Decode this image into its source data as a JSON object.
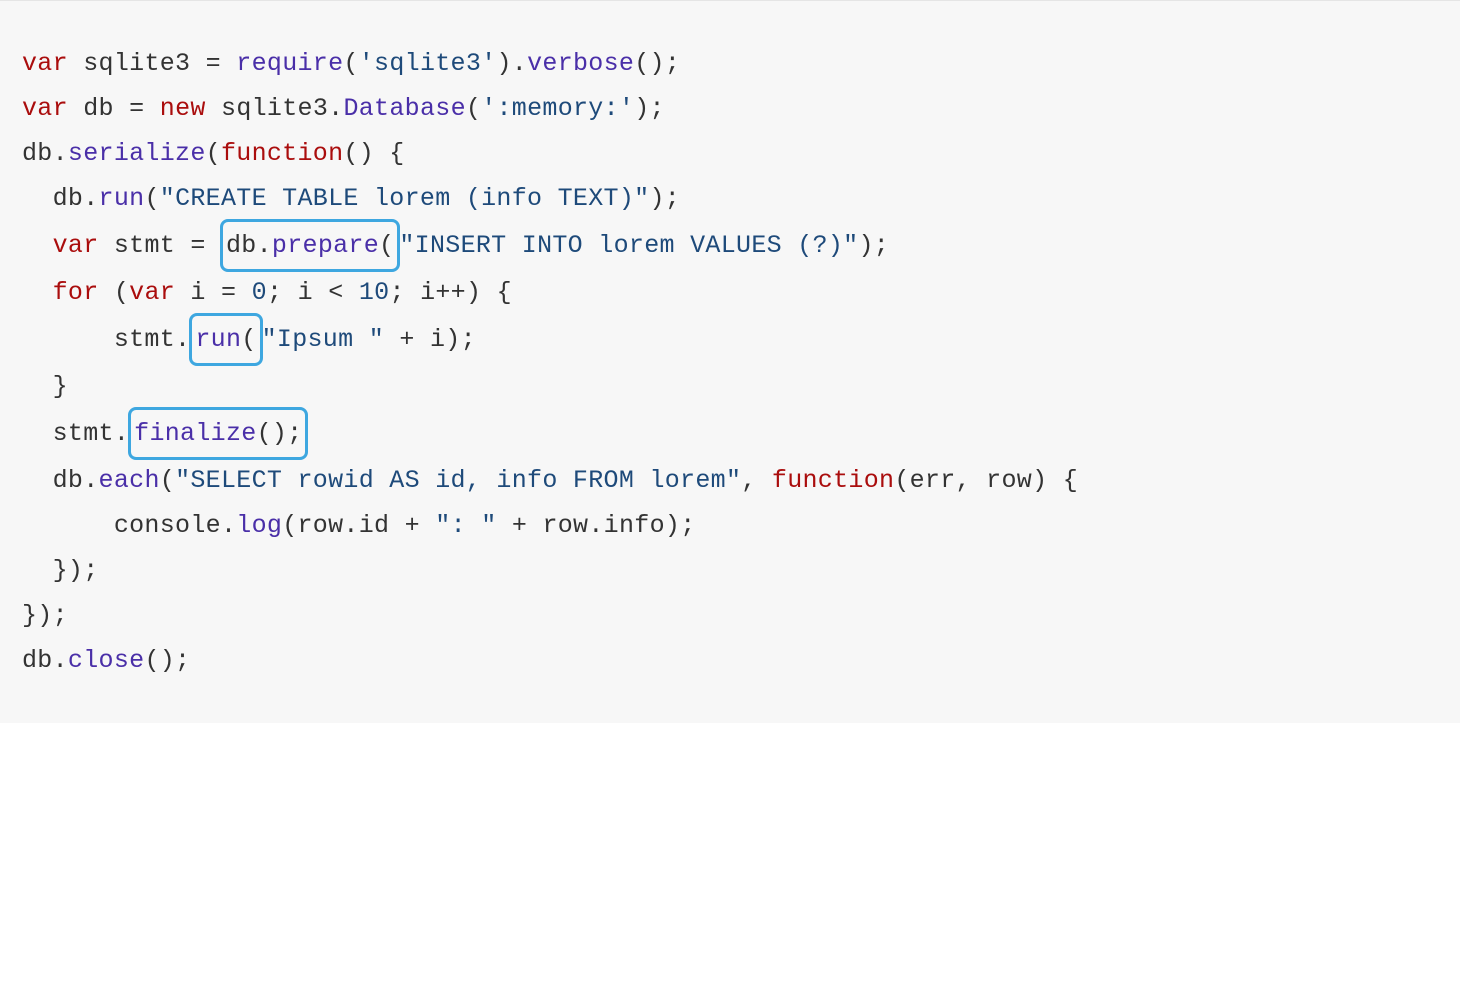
{
  "code": {
    "lines": [
      {
        "id": 1,
        "tokens": [
          {
            "t": "var",
            "c": "k"
          },
          {
            "t": " "
          },
          {
            "t": "sqlite3",
            "c": "nm"
          },
          {
            "t": " "
          },
          {
            "t": "=",
            "c": "op"
          },
          {
            "t": " "
          },
          {
            "t": "require",
            "c": "fn"
          },
          {
            "t": "(",
            "c": "p"
          },
          {
            "t": "'sqlite3'",
            "c": "s"
          },
          {
            "t": ")",
            "c": "p"
          },
          {
            "t": ".",
            "c": "p"
          },
          {
            "t": "verbose",
            "c": "fn"
          },
          {
            "t": "();",
            "c": "p"
          }
        ]
      },
      {
        "id": 2,
        "tokens": [
          {
            "t": "var",
            "c": "k"
          },
          {
            "t": " "
          },
          {
            "t": "db",
            "c": "nm"
          },
          {
            "t": " "
          },
          {
            "t": "=",
            "c": "op"
          },
          {
            "t": " "
          },
          {
            "t": "new",
            "c": "k"
          },
          {
            "t": " "
          },
          {
            "t": "sqlite3",
            "c": "nm"
          },
          {
            "t": ".",
            "c": "p"
          },
          {
            "t": "Database",
            "c": "fn"
          },
          {
            "t": "(",
            "c": "p"
          },
          {
            "t": "':memory:'",
            "c": "s"
          },
          {
            "t": ");",
            "c": "p"
          }
        ]
      },
      {
        "id": 3,
        "tokens": [
          {
            "t": ""
          }
        ]
      },
      {
        "id": 4,
        "tokens": [
          {
            "t": "db",
            "c": "nm"
          },
          {
            "t": ".",
            "c": "p"
          },
          {
            "t": "serialize",
            "c": "fn"
          },
          {
            "t": "(",
            "c": "p"
          },
          {
            "t": "function",
            "c": "k"
          },
          {
            "t": "() {",
            "c": "p"
          }
        ]
      },
      {
        "id": 5,
        "tokens": [
          {
            "t": "  "
          },
          {
            "t": "db",
            "c": "nm"
          },
          {
            "t": ".",
            "c": "p"
          },
          {
            "t": "run",
            "c": "fn"
          },
          {
            "t": "(",
            "c": "p"
          },
          {
            "t": "\"CREATE TABLE lorem (info TEXT)\"",
            "c": "s"
          },
          {
            "t": ");",
            "c": "p"
          }
        ]
      },
      {
        "id": 6,
        "tokens": [
          {
            "t": ""
          }
        ]
      },
      {
        "id": 7,
        "tokens": [
          {
            "t": "  "
          },
          {
            "t": "var",
            "c": "k"
          },
          {
            "t": " "
          },
          {
            "t": "stmt",
            "c": "nm"
          },
          {
            "t": " "
          },
          {
            "t": "=",
            "c": "op"
          },
          {
            "t": " "
          },
          {
            "box": true,
            "inner": [
              {
                "t": "db",
                "c": "nm"
              },
              {
                "t": ".",
                "c": "p"
              },
              {
                "t": "prepare",
                "c": "fn"
              },
              {
                "t": "(",
                "c": "p"
              }
            ]
          },
          {
            "t": "\"INSERT INTO lorem VALUES (?)\"",
            "c": "s"
          },
          {
            "t": ");",
            "c": "p"
          }
        ]
      },
      {
        "id": 8,
        "tokens": [
          {
            "t": "  "
          },
          {
            "t": "for",
            "c": "k"
          },
          {
            "t": " "
          },
          {
            "t": "(",
            "c": "p"
          },
          {
            "t": "var",
            "c": "k"
          },
          {
            "t": " "
          },
          {
            "t": "i",
            "c": "nm"
          },
          {
            "t": " "
          },
          {
            "t": "=",
            "c": "op"
          },
          {
            "t": " "
          },
          {
            "t": "0",
            "c": "n"
          },
          {
            "t": ";",
            "c": "p"
          },
          {
            "t": " "
          },
          {
            "t": "i",
            "c": "nm"
          },
          {
            "t": " "
          },
          {
            "t": "<",
            "c": "op"
          },
          {
            "t": " "
          },
          {
            "t": "10",
            "c": "n"
          },
          {
            "t": ";",
            "c": "p"
          },
          {
            "t": " "
          },
          {
            "t": "i",
            "c": "nm"
          },
          {
            "t": "++",
            "c": "op"
          },
          {
            "t": ")",
            "c": "p"
          },
          {
            "t": " {",
            "c": "p"
          }
        ]
      },
      {
        "id": 9,
        "tokens": [
          {
            "t": "      "
          },
          {
            "t": "stmt",
            "c": "nm"
          },
          {
            "t": ".",
            "c": "p"
          },
          {
            "box": true,
            "inner": [
              {
                "t": "run",
                "c": "fn"
              },
              {
                "t": "(",
                "c": "p"
              }
            ]
          },
          {
            "t": "\"Ipsum \"",
            "c": "s"
          },
          {
            "t": " "
          },
          {
            "t": "+",
            "c": "op"
          },
          {
            "t": " "
          },
          {
            "t": "i",
            "c": "nm"
          },
          {
            "t": ");",
            "c": "p"
          }
        ]
      },
      {
        "id": 10,
        "tokens": [
          {
            "t": "  "
          },
          {
            "t": "}",
            "c": "p"
          }
        ]
      },
      {
        "id": 11,
        "tokens": [
          {
            "t": "  "
          },
          {
            "t": "stmt",
            "c": "nm"
          },
          {
            "t": ".",
            "c": "p"
          },
          {
            "box": true,
            "inner": [
              {
                "t": "finalize",
                "c": "fn"
              },
              {
                "t": "();",
                "c": "p"
              }
            ]
          }
        ]
      },
      {
        "id": 12,
        "tokens": [
          {
            "t": ""
          }
        ]
      },
      {
        "id": 13,
        "tokens": [
          {
            "t": "  "
          },
          {
            "t": "db",
            "c": "nm"
          },
          {
            "t": ".",
            "c": "p"
          },
          {
            "t": "each",
            "c": "fn"
          },
          {
            "t": "(",
            "c": "p"
          },
          {
            "t": "\"SELECT rowid AS id, info FROM lorem\"",
            "c": "s"
          },
          {
            "t": ",",
            "c": "p"
          },
          {
            "t": " "
          },
          {
            "t": "function",
            "c": "k"
          },
          {
            "t": "(",
            "c": "p"
          },
          {
            "t": "err",
            "c": "nm"
          },
          {
            "t": ",",
            "c": "p"
          },
          {
            "t": " "
          },
          {
            "t": "row",
            "c": "nm"
          },
          {
            "t": ")",
            "c": "p"
          },
          {
            "t": " {",
            "c": "p"
          }
        ]
      },
      {
        "id": 14,
        "tokens": [
          {
            "t": "      "
          },
          {
            "t": "console",
            "c": "nm"
          },
          {
            "t": ".",
            "c": "p"
          },
          {
            "t": "log",
            "c": "fn"
          },
          {
            "t": "(",
            "c": "p"
          },
          {
            "t": "row",
            "c": "nm"
          },
          {
            "t": ".",
            "c": "p"
          },
          {
            "t": "id",
            "c": "nm"
          },
          {
            "t": " "
          },
          {
            "t": "+",
            "c": "op"
          },
          {
            "t": " "
          },
          {
            "t": "\": \"",
            "c": "s"
          },
          {
            "t": " "
          },
          {
            "t": "+",
            "c": "op"
          },
          {
            "t": " "
          },
          {
            "t": "row",
            "c": "nm"
          },
          {
            "t": ".",
            "c": "p"
          },
          {
            "t": "info",
            "c": "nm"
          },
          {
            "t": ");",
            "c": "p"
          }
        ]
      },
      {
        "id": 15,
        "tokens": [
          {
            "t": "  "
          },
          {
            "t": "});",
            "c": "p"
          }
        ]
      },
      {
        "id": 16,
        "tokens": [
          {
            "t": "});",
            "c": "p"
          }
        ]
      },
      {
        "id": 17,
        "tokens": [
          {
            "t": ""
          }
        ]
      },
      {
        "id": 18,
        "tokens": [
          {
            "t": "db",
            "c": "nm"
          },
          {
            "t": ".",
            "c": "p"
          },
          {
            "t": "close",
            "c": "fn"
          },
          {
            "t": "();",
            "c": "p"
          }
        ]
      }
    ]
  },
  "highlight_boxes": [
    "db.prepare(",
    "run(",
    "finalize();"
  ],
  "colors": {
    "background": "#f7f7f7",
    "keyword": "#aa0d0d",
    "function": "#4a2fa8",
    "string": "#1e4a7a",
    "number": "#1e4a7a",
    "default": "#333333",
    "highlight_border": "#3ea7e0"
  }
}
